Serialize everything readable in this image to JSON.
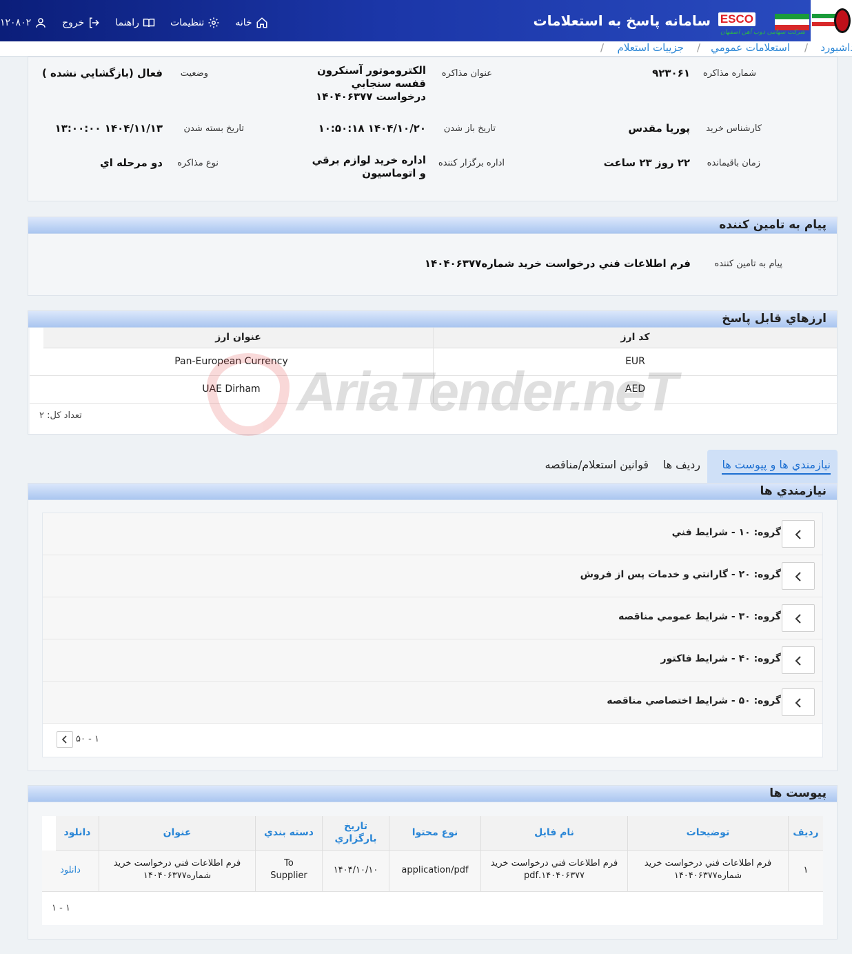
{
  "header": {
    "system_title": "سامانه پاسخ به استعلامات",
    "brand": "ESCO",
    "brand_sub": "شرکت سهامی ذوب آهن اصفهان",
    "nav": {
      "home": "خانه",
      "settings": "تنظیمات",
      "guide": "راهنما",
      "logout": "خروج",
      "user_code": "۱۲۰۸۰۲"
    }
  },
  "breadcrumb": [
    "داشبورد",
    "استعلامات عمومي",
    "جزييات استعلام"
  ],
  "details": {
    "number_label": "شماره مذاكره",
    "number": "۹۲۳۰۶۱",
    "subject_label": "عنوان مذاكره",
    "subject": "الکتروموتور آسنکرون قفسه سنجابي درخواست ۱۴۰۴۰۶۳۷۷",
    "status_label": "وضعيت",
    "status": "فعال (بازگشايي نشده )",
    "buyer_label": "كارشناس خريد",
    "buyer": "پوريا مقدس",
    "open_label": "تاريخ باز شدن",
    "open_date": "۱۴۰۴/۱۰/۲۰ ۱۰:۵۰:۱۸",
    "close_label": "تاريخ بسته شدن",
    "close_date": "۱۴۰۴/۱۱/۱۳ ۱۳:۰۰:۰۰",
    "remaining_label": "زمان باقيمانده",
    "remaining": "۲۲ روز ۲۳ ساعت",
    "dept_label": "اداره برگزار كننده",
    "dept": "اداره خريد لوازم برقي و اتوماسيون",
    "type_label": "نوع مذاكره",
    "type": "دو مرحله اي"
  },
  "message": {
    "title": "پيام به تامين كننده",
    "label": "پيام به تامين كننده",
    "text": "فرم اطلاعات فني درخواست خريد شماره۱۴۰۴۰۶۳۷۷"
  },
  "currencies": {
    "title": "ارزهاي قابل پاسخ",
    "col_code": "كد ارز",
    "col_title": "عنوان ارز",
    "rows": [
      {
        "code": "EUR",
        "title": "Pan-European Currency"
      },
      {
        "code": "AED",
        "title": "UAE Dirham"
      }
    ],
    "total": "تعداد كل: ۲"
  },
  "tabs": [
    "نيازمندي ها و پيوست ها",
    "رديف ها",
    "قوانين استعلام/مناقصه"
  ],
  "requirements": {
    "title": "نيازمندي ها",
    "groups": [
      "گروه: ۱۰ - شرايط فني",
      "گروه: ۲۰ - گارانتي و خدمات پس از فروش",
      "گروه: ۳۰ - شرايط عمومي مناقصه",
      "گروه: ۴۰ - شرايط فاكتور",
      "گروه: ۵۰ - شرايط اختصاصي مناقصه"
    ],
    "pager": "۱ - ۵۰"
  },
  "attachments": {
    "title": "پيوست ها",
    "headers": {
      "row": "رديف",
      "desc": "توضيحات",
      "file": "نام فايل",
      "content": "نوع محتوا",
      "date": "تاريخ بارگزاري",
      "category": "دسته بندي",
      "title": "عنوان",
      "download": "دانلود"
    },
    "rows": [
      {
        "row": "۱",
        "desc": "فرم اطلاعات فني درخواست خريد شماره۱۴۰۴۰۶۳۷۷",
        "file": "فرم اطلاعات فني درخواست خريد ۱۴۰۴۰۶۳۷۷.pdf",
        "content": "application/pdf",
        "date": "۱۴۰۴/۱۰/۱۰",
        "category": "To Supplier",
        "title": "فرم اطلاعات فني درخواست خريد شماره۱۴۰۴۰۶۳۷۷",
        "download": "دانلود"
      }
    ],
    "pager": "۱ - ۱"
  },
  "watermark": "AriaTender.neT",
  "colors": {
    "header_bg": "#1b36a8",
    "panel_head": "#aac6f0",
    "link": "#2a86d6",
    "brand_red": "#e01f26"
  }
}
